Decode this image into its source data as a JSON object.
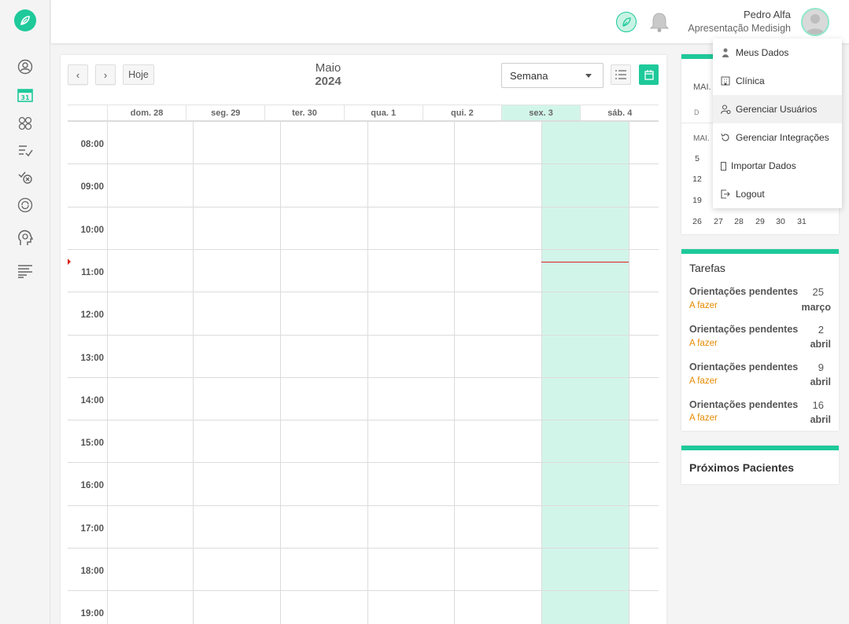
{
  "header": {
    "user_name": "Pedro Alfa",
    "user_org": "Apresentação Medisigh"
  },
  "sidebar": {
    "items": [
      {
        "icon": "patient-icon"
      },
      {
        "icon": "calendar-icon"
      },
      {
        "icon": "groups-icon"
      },
      {
        "icon": "checklist-icon"
      },
      {
        "icon": "cancel-icon"
      },
      {
        "icon": "refresh-icon"
      },
      {
        "icon": "mind-icon"
      },
      {
        "icon": "reports-icon"
      }
    ]
  },
  "calendar": {
    "today_label": "Hoje",
    "month": "Maio",
    "year": "2024",
    "view_selected": "Semana",
    "days": [
      "dom. 28",
      "seg. 29",
      "ter. 30",
      "qua. 1",
      "qui. 2",
      "sex. 3",
      "sáb. 4"
    ],
    "today_index": 5,
    "hours": [
      "08:00",
      "09:00",
      "10:00",
      "11:00",
      "12:00",
      "13:00",
      "14:00",
      "15:00",
      "16:00",
      "17:00",
      "18:00",
      "19:00"
    ]
  },
  "mini_calendar": {
    "header": "MAI.",
    "dow_first": "D",
    "month_label": "MAI.",
    "col1": [
      "5",
      "12",
      "19"
    ],
    "last_row": [
      "26",
      "27",
      "28",
      "29",
      "30",
      "31"
    ]
  },
  "tasks": {
    "title": "Tarefas",
    "items": [
      {
        "name": "Orientações pendentes",
        "status": "A fazer",
        "day": "25",
        "month": "março"
      },
      {
        "name": "Orientações pendentes",
        "status": "A fazer",
        "day": "2",
        "month": "abril"
      },
      {
        "name": "Orientações pendentes",
        "status": "A fazer",
        "day": "9",
        "month": "abril"
      },
      {
        "name": "Orientações pendentes",
        "status": "A fazer",
        "day": "16",
        "month": "abril"
      }
    ]
  },
  "next_patients": {
    "title": "Próximos Pacientes"
  },
  "user_menu": {
    "items": [
      {
        "label": "Meus Dados",
        "icon": "person-icon"
      },
      {
        "label": "Clínica",
        "icon": "building-icon"
      },
      {
        "label": "Gerenciar Usuários",
        "icon": "user-settings-icon"
      },
      {
        "label": "Gerenciar Integrações",
        "icon": "sync-icon"
      },
      {
        "label": "Importar Dados",
        "icon": "file-icon"
      },
      {
        "label": "Logout",
        "icon": "logout-icon"
      }
    ],
    "active_index": 2
  },
  "colors": {
    "accent": "#1ec99a",
    "today_bg": "#d2f5ea",
    "now_line": "#d9231b",
    "task_status": "#e68a00"
  }
}
